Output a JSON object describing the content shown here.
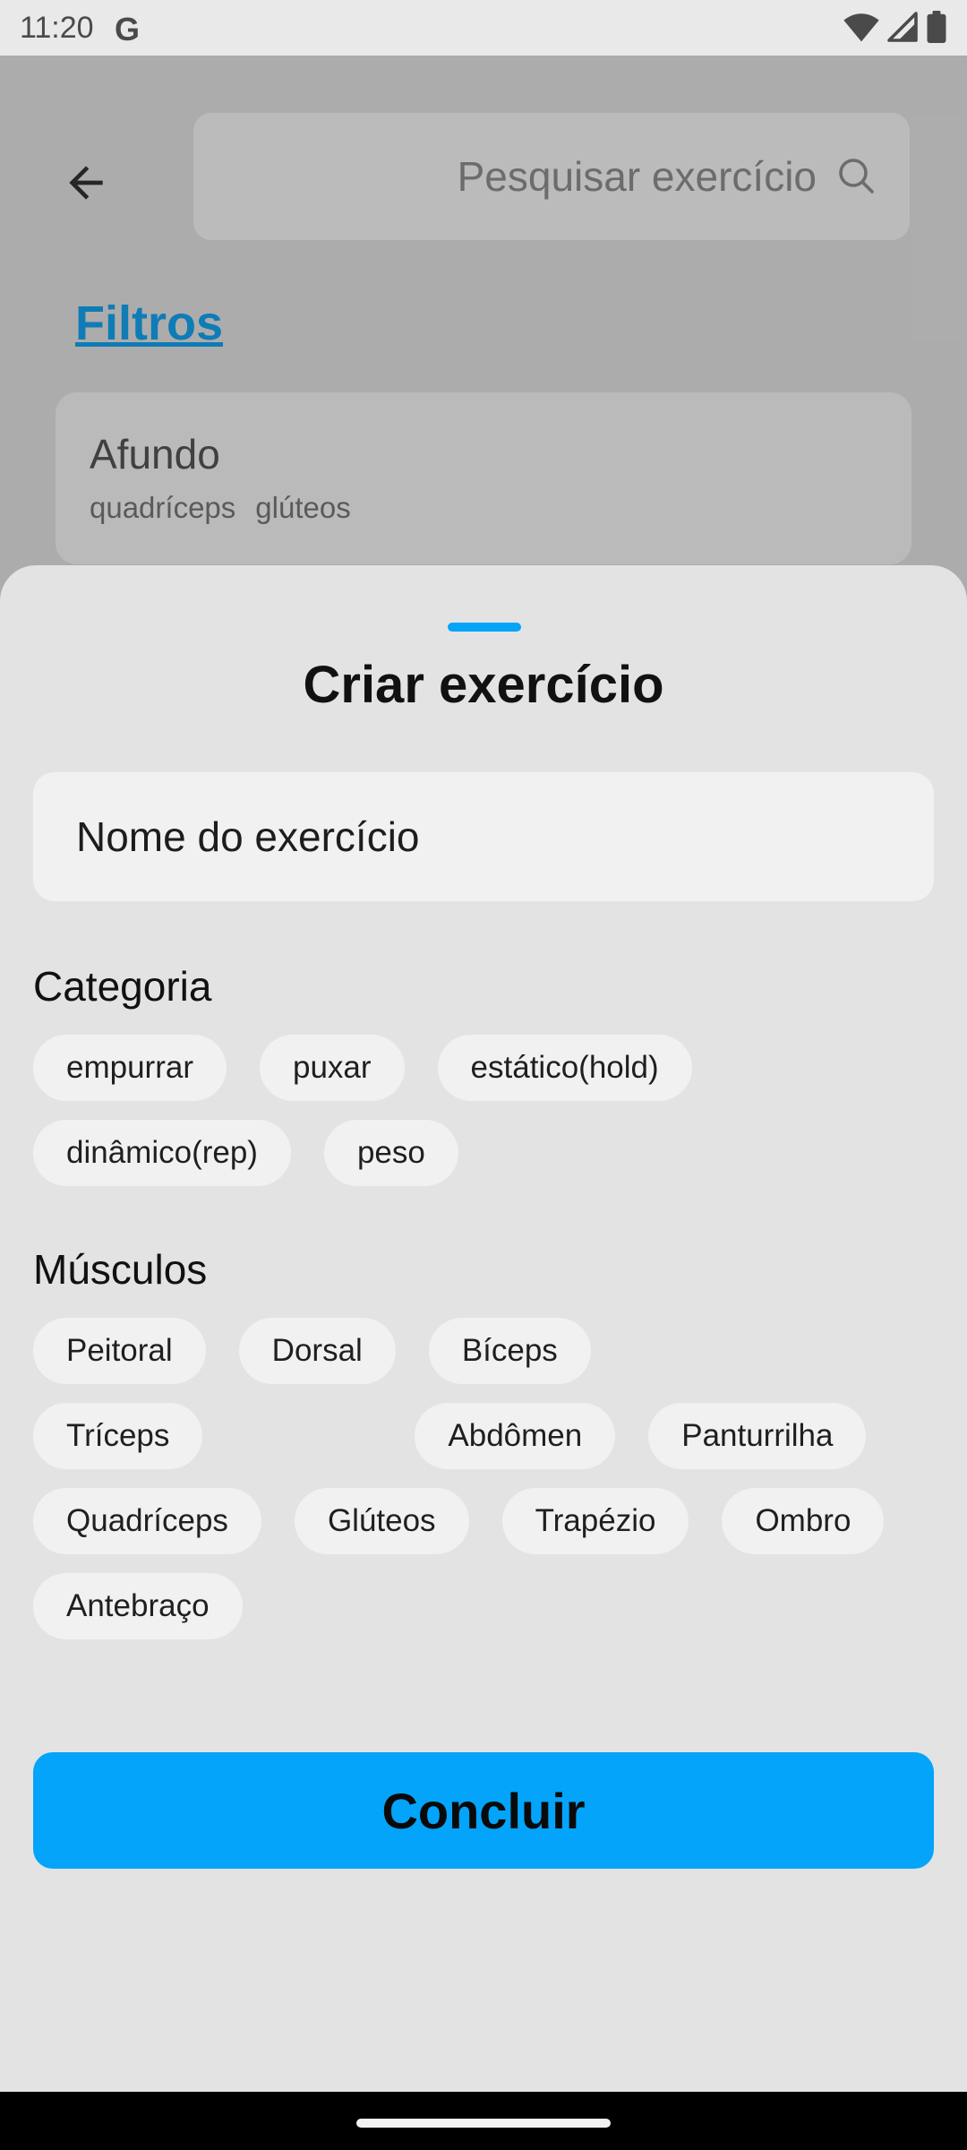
{
  "status_bar": {
    "time": "11:20",
    "google_letter": "G"
  },
  "background_page": {
    "search": {
      "placeholder": "Pesquisar exercício"
    },
    "filters_label": "Filtros",
    "exercise_card": {
      "name": "Afundo",
      "tags": [
        "quadríceps",
        "glúteos"
      ]
    }
  },
  "sheet": {
    "title": "Criar exercício",
    "name_field": {
      "placeholder": "Nome do exercício"
    },
    "category": {
      "label": "Categoria",
      "options": [
        "empurrar",
        "puxar",
        "estático(hold)",
        "dinâmico(rep)",
        "peso"
      ]
    },
    "muscles": {
      "label": "Músculos",
      "options": [
        "Peitoral",
        "Dorsal",
        "Bíceps",
        "Tríceps",
        "Abdômen",
        "Panturrilha",
        "Quadríceps",
        "Glúteos",
        "Trapézio",
        "Ombro",
        "Antebraço"
      ]
    },
    "done_label": "Concluir"
  },
  "colors": {
    "accent": "#04a4fa",
    "link": "#15a4f0",
    "sheet_background": "#e3e3e3",
    "chip_background": "#f1f1f1"
  },
  "icons": {
    "status": [
      "wifi-icon",
      "signal-icon",
      "battery-icon"
    ],
    "header": [
      "back-arrow-icon",
      "search-icon"
    ]
  }
}
